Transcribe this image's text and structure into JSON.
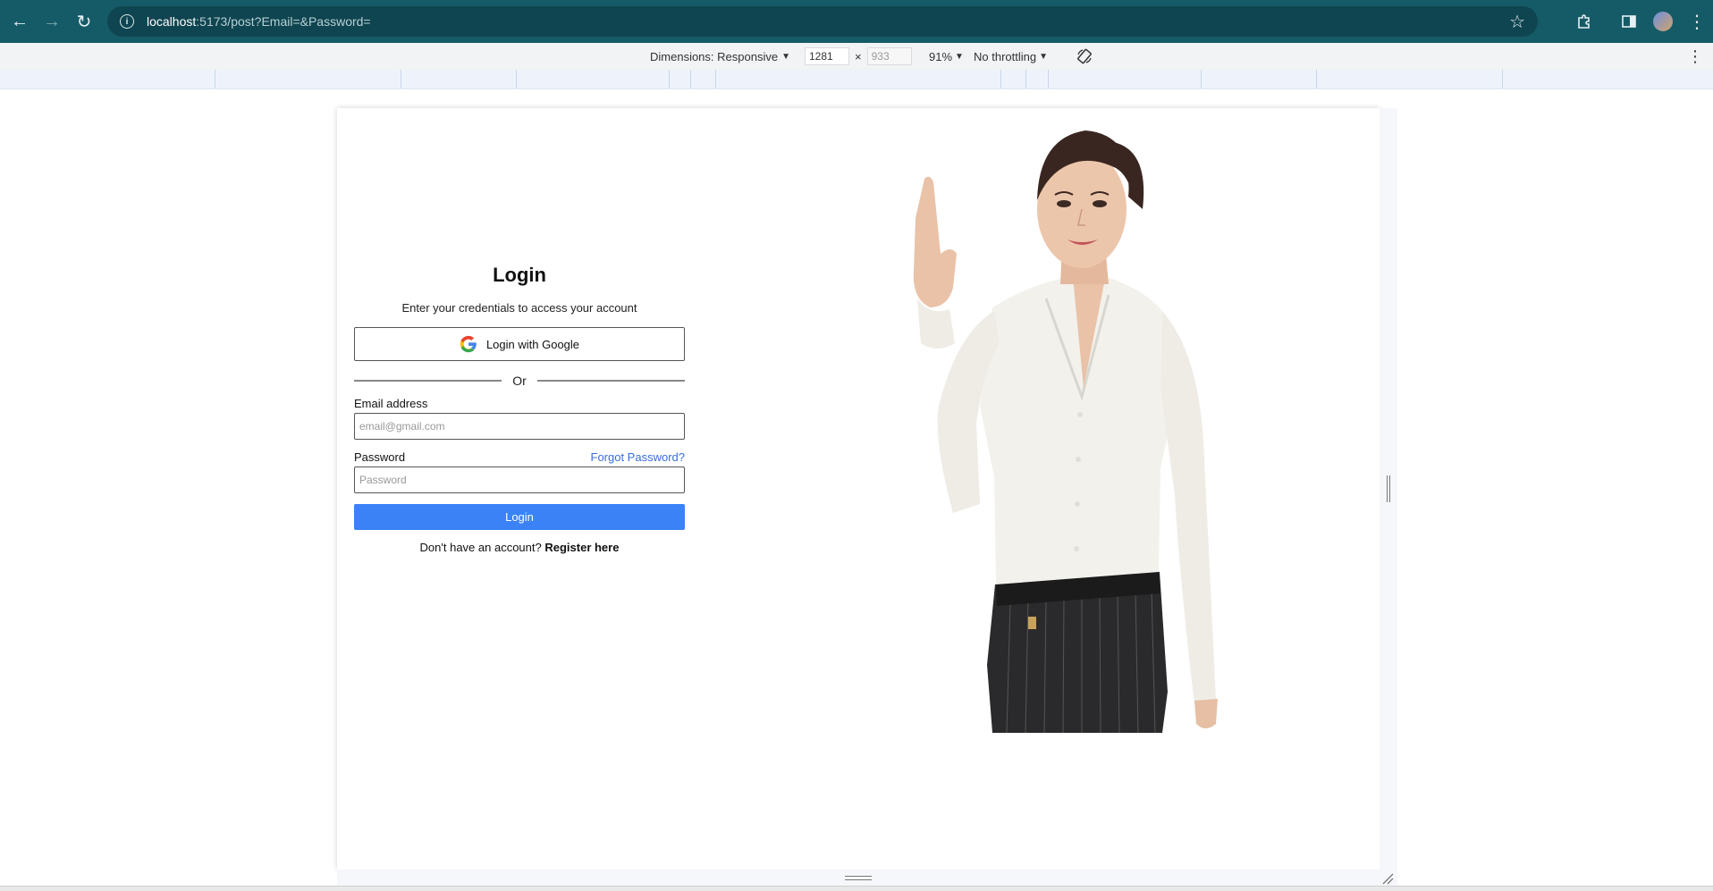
{
  "browser": {
    "url_host": "localhost",
    "url_rest": ":5173/post?Email=&Password="
  },
  "devtools": {
    "dimensions_label": "Dimensions: Responsive",
    "width": "1281",
    "height_placeholder": "933",
    "times": "×",
    "zoom": "91%",
    "throttling": "No throttling"
  },
  "login": {
    "title": "Login",
    "subtitle": "Enter your credentials to access your account",
    "google_button": "Login with Google",
    "divider_text": "Or",
    "email_label": "Email address",
    "email_placeholder": "email@gmail.com",
    "password_label": "Password",
    "forgot_password": "Forgot Password?",
    "password_placeholder": "Password",
    "submit": "Login",
    "register_prompt": "Don't have an account?",
    "register_link": "Register here"
  },
  "colors": {
    "toolbar": "#155a67",
    "primary_button": "#3b82f6",
    "link": "#3a6fd8"
  }
}
